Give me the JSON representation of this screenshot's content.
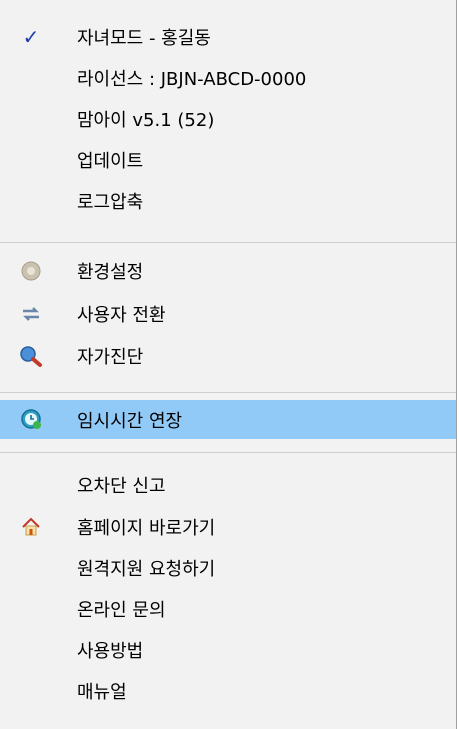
{
  "menu": {
    "items": [
      {
        "label": "자녀모드 - 홍길동",
        "icon": "check-icon",
        "checked": true
      },
      {
        "label": "라이선스 :  JBJN-ABCD-0000"
      },
      {
        "label": "맘아이 v5.1  (52)"
      },
      {
        "label": "업데이트"
      },
      {
        "label": "로그압축"
      },
      {
        "label": "환경설정",
        "icon": "gear-icon"
      },
      {
        "label": "사용자 전환",
        "icon": "switch-user-icon"
      },
      {
        "label": "자가진단",
        "icon": "magnifier-icon"
      },
      {
        "label": "임시시간 연장",
        "icon": "clock-icon",
        "highlighted": true
      },
      {
        "label": "오차단 신고"
      },
      {
        "label": "홈페이지 바로가기",
        "icon": "home-icon"
      },
      {
        "label": "원격지원 요청하기"
      },
      {
        "label": "온라인 문의"
      },
      {
        "label": "사용방법"
      },
      {
        "label": "매뉴얼"
      }
    ]
  },
  "colors": {
    "highlight": "#91c9f7",
    "check": "#1b3ea8",
    "menu_bg": "#f2f2f2"
  }
}
